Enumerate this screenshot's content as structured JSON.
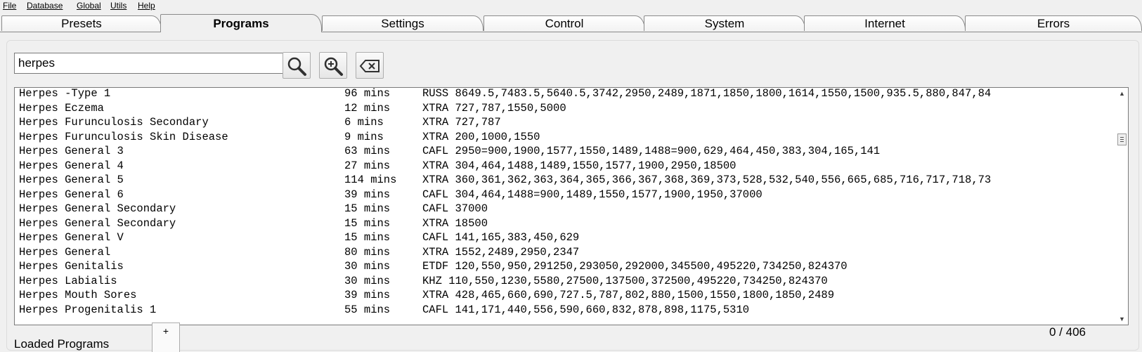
{
  "menu": [
    "File",
    "Database",
    "Global",
    "Utils",
    "Help"
  ],
  "tabs": [
    "Presets",
    "Programs",
    "Settings",
    "Control",
    "System",
    "Internet",
    "Errors"
  ],
  "active_tab": "Programs",
  "search": {
    "value": "herpes"
  },
  "buttons": {
    "search_icon": "magnifier-icon",
    "zoom_icon": "zoom-in-icon",
    "clear_icon": "backspace-clear-icon"
  },
  "rows": [
    {
      "name": "Herpes -Type 1",
      "duration": "96 mins",
      "freqs": "RUSS 8649.5,7483.5,5640.5,3742,2950,2489,1871,1850,1800,1614,1550,1500,935.5,880,847,84"
    },
    {
      "name": "Herpes Eczema",
      "duration": "12 mins",
      "freqs": "XTRA 727,787,1550,5000"
    },
    {
      "name": "Herpes Furunculosis Secondary",
      "duration": "6 mins",
      "freqs": "XTRA 727,787"
    },
    {
      "name": "Herpes Furunculosis Skin Disease",
      "duration": "9 mins",
      "freqs": "XTRA 200,1000,1550"
    },
    {
      "name": "Herpes General 3",
      "duration": "63 mins",
      "freqs": "CAFL 2950=900,1900,1577,1550,1489,1488=900,629,464,450,383,304,165,141"
    },
    {
      "name": "Herpes General 4",
      "duration": "27 mins",
      "freqs": "XTRA 304,464,1488,1489,1550,1577,1900,2950,18500"
    },
    {
      "name": "Herpes General 5",
      "duration": "114 mins",
      "freqs": "XTRA 360,361,362,363,364,365,366,367,368,369,373,528,532,540,556,665,685,716,717,718,73"
    },
    {
      "name": "Herpes General 6",
      "duration": "39 mins",
      "freqs": "CAFL 304,464,1488=900,1489,1550,1577,1900,1950,37000"
    },
    {
      "name": "Herpes General Secondary",
      "duration": "15 mins",
      "freqs": "CAFL 37000"
    },
    {
      "name": "Herpes General Secondary",
      "duration": "15 mins",
      "freqs": "XTRA 18500"
    },
    {
      "name": "Herpes General V",
      "duration": "15 mins",
      "freqs": "CAFL 141,165,383,450,629"
    },
    {
      "name": "Herpes General",
      "duration": "80 mins",
      "freqs": "XTRA 1552,2489,2950,2347"
    },
    {
      "name": "Herpes Genitalis",
      "duration": "30 mins",
      "freqs": "ETDF 120,550,950,291250,293050,292000,345500,495220,734250,824370"
    },
    {
      "name": "Herpes Labialis",
      "duration": "30 mins",
      "freqs": "KHZ  110,550,1230,5580,27500,137500,372500,495220,734250,824370"
    },
    {
      "name": "Herpes Mouth Sores",
      "duration": "39 mins",
      "freqs": "XTRA 428,465,660,690,727.5,787,802,880,1500,1550,1800,1850,2489"
    },
    {
      "name": "Herpes Progenitalis 1",
      "duration": "55 mins",
      "freqs": "CAFL 141,171,440,556,590,660,832,878,898,1175,5310"
    }
  ],
  "counter": "0 / 406",
  "bottom": {
    "label": "Loaded Programs",
    "plus": "+"
  }
}
